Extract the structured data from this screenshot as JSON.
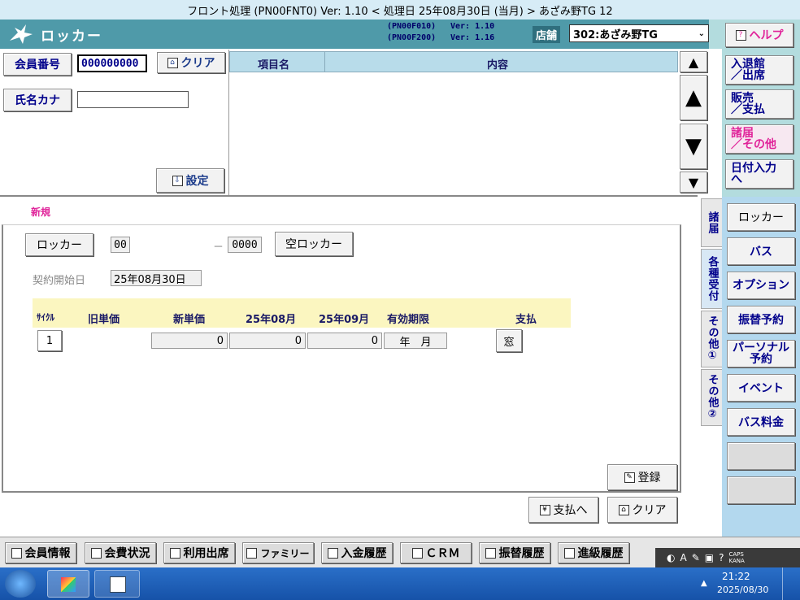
{
  "window": {
    "title": "フロント処理 (PN00FNT0) Ver: 1.10 < 処理日 25年08月30日 (当月) > あざみ野TG 12"
  },
  "header": {
    "app_name": "ロッカー",
    "module1": "(PN00F010)",
    "module1_ver": "Ver: 1.10",
    "module2": "(PN00F200)",
    "module2_ver": "Ver: 1.16",
    "store_label": "店舗",
    "store_value": "302:あざみ野TG",
    "help_label": "ヘルプ"
  },
  "member": {
    "number_label": "会員番号",
    "number_value": "000000000",
    "clear_label": "クリア",
    "kana_label": "氏名カナ",
    "kana_value": "",
    "setting_label": "設定"
  },
  "info_table": {
    "col_item": "項目名",
    "col_content": "内容"
  },
  "nav": {
    "top": "⏫",
    "up": "▲",
    "down": "▼",
    "bottom": "⏬"
  },
  "side_menu": [
    {
      "line1": "入退館",
      "line2": "／出席"
    },
    {
      "line1": "販売",
      "line2": "／支払"
    },
    {
      "line1": "諸届",
      "line2": "／その他"
    },
    {
      "line1": "日付入力",
      "line2": "へ"
    }
  ],
  "vertical_tabs": [
    "諸届",
    "各種受付",
    "その他①",
    "その他②"
  ],
  "sub_menu": [
    "ロッカー",
    "バス",
    "オプション",
    "振替予約",
    "パーソナル予約",
    "イベント",
    "バス料金",
    "",
    ""
  ],
  "form": {
    "mode": "新規",
    "locker_label": "ロッカー",
    "locker_no1": "00",
    "dash": "－",
    "locker_no2": "0000",
    "empty_locker_label": "空ロッカー",
    "contract_start_label": "契約開始日",
    "contract_start_value": "25年08月30日",
    "columns": [
      "ｻｲｸﾙ",
      "旧単価",
      "新単価",
      "25年08月",
      "25年09月",
      "有効期限",
      "支払"
    ],
    "row": {
      "cycle": "1",
      "old_price": "",
      "new_price": "0",
      "aug": "0",
      "sep": "0",
      "expiry": "年　月",
      "pay": "窓"
    },
    "register_label": "登録",
    "to_payment_label": "支払へ",
    "clear_label": "クリア"
  },
  "bottom_bar": [
    "会員情報",
    "会費状況",
    "利用出席",
    "ファミリー",
    "入金履歴",
    "ＣＲＭ",
    "振替履歴",
    "進級履歴"
  ],
  "taskbar": {
    "time": "21:22",
    "date": "2025/08/30",
    "caps": "CAPS",
    "kana": "KANA"
  },
  "colors": {
    "header_teal": "#4f9aa9",
    "accent_magenta": "#e0249a",
    "label_blue": "#00008b"
  }
}
